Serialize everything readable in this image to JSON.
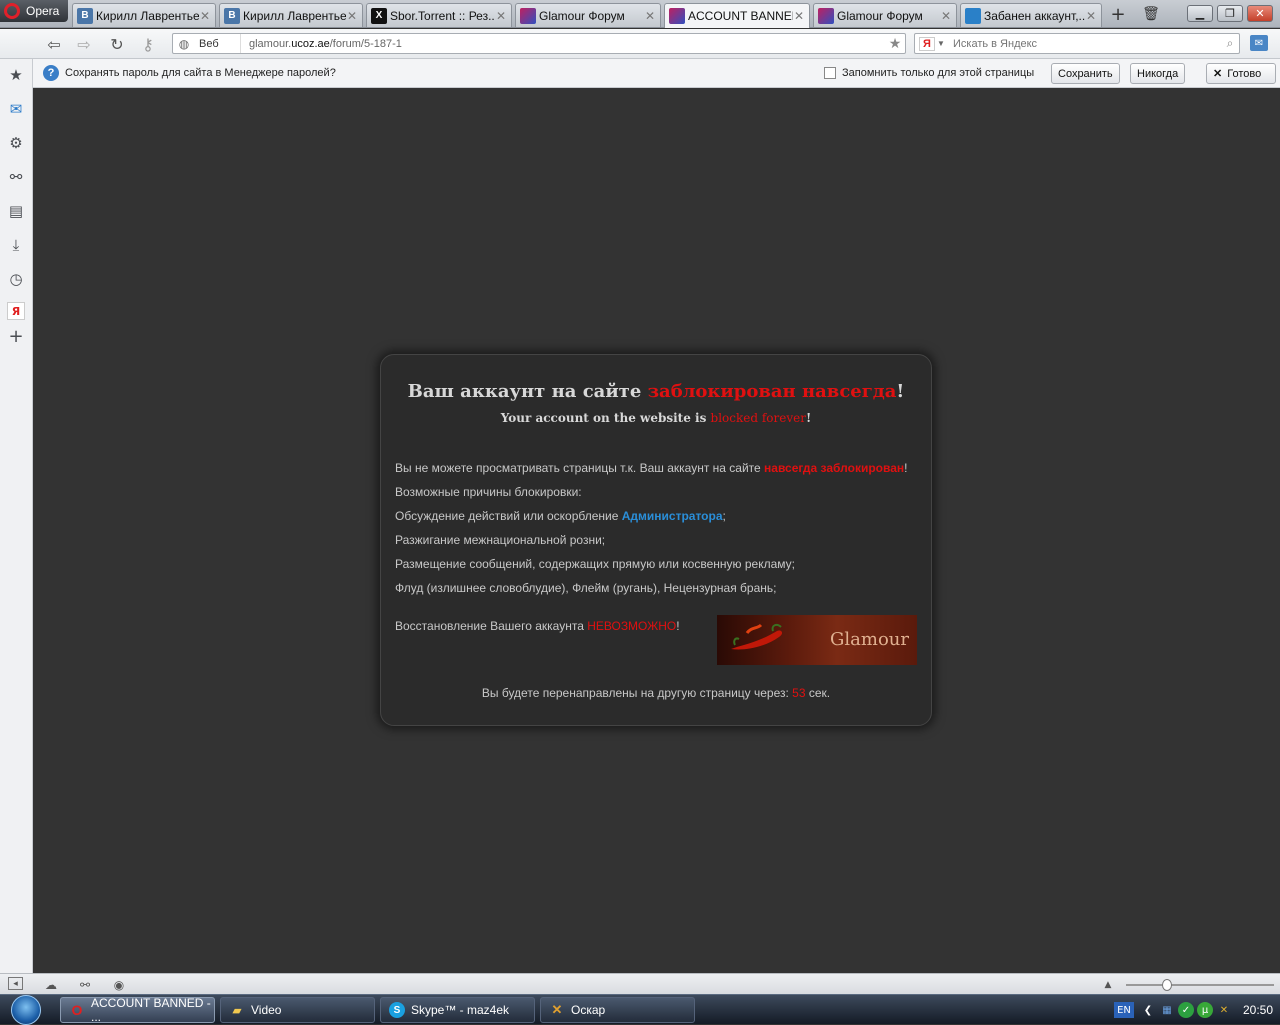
{
  "browser": {
    "menu_label": "Opera",
    "tabs": [
      {
        "label": "Кирилл Лаврентьев",
        "icon": "vk-icon",
        "fav_letter": "B"
      },
      {
        "label": "Кирилл Лаврентьев",
        "icon": "vk-icon",
        "fav_letter": "B"
      },
      {
        "label": "Sbor.Torrent :: Рез...",
        "icon": "torrent-icon",
        "fav_letter": "X"
      },
      {
        "label": "Glamour Форум",
        "icon": "glamour-icon",
        "fav_letter": ""
      },
      {
        "label": "ACCOUNT BANNED",
        "icon": "glamour-icon",
        "fav_letter": "",
        "active": true
      },
      {
        "label": "Glamour Форум",
        "icon": "glamour-icon",
        "fav_letter": ""
      },
      {
        "label": "Забанен аккаунт,...",
        "icon": "ucoz-icon",
        "fav_letter": ""
      }
    ]
  },
  "addressbar": {
    "web_label": "Веб",
    "url_prefix": "glamour.",
    "url_host": "ucoz.ae",
    "url_path": "/forum/5-187-1",
    "search_engine_letter": "Я",
    "search_placeholder": "Искать в Яндекс"
  },
  "password_bar": {
    "info_glyph": "?",
    "message": "Сохранять пароль для сайта в Менеджере паролей?",
    "checkbox_label": "Запомнить только для этой страницы",
    "save_label": "Сохранить",
    "never_label": "Никогда",
    "done_label": "Готово"
  },
  "ban": {
    "title_prefix": "Ваш аккаунт на сайте ",
    "title_red": "заблокирован навсегда",
    "title_suffix": "!",
    "subtitle_prefix": "Your account on the website is ",
    "subtitle_red": "blocked forever",
    "subtitle_suffix": "!",
    "line1_prefix": "Вы не можете просматривать страницы т.к. Ваш аккаунт на сайте ",
    "line1_red": "навсегда заблокирован",
    "line1_suffix": "!",
    "reasons_heading": "Возможные причины блокировки:",
    "reason1_prefix": "Обсуждение действий или оскорбление ",
    "reason1_link": "Администратора",
    "reason1_suffix": ";",
    "reason2": "Разжигание межнациональной розни;",
    "reason3": "Размещение сообщений, содержащих прямую или косвенную рекламу;",
    "reason4": "Флуд (излишнее словоблудие), Флейм (ругань), Нецензурная брань;",
    "restore_prefix": "Восстановление Вашего аккаунта ",
    "restore_red": "НЕВОЗМОЖНО",
    "restore_suffix": "!",
    "banner_brand": "Glamour",
    "redirect_prefix": "Вы будете перенаправлены на другую страницу через: ",
    "redirect_seconds": "53",
    "redirect_suffix": " сек."
  },
  "statusbar": {
    "zoom_fraction": 0.28
  },
  "taskbar": {
    "items": [
      {
        "label": "ACCOUNT BANNED - ...",
        "icon": "opera-icon",
        "active": true
      },
      {
        "label": "Video",
        "icon": "folder-icon"
      },
      {
        "label": "Skype™ - maz4ek",
        "icon": "skype-icon"
      },
      {
        "label": "Оскар",
        "icon": "oscar-icon"
      }
    ],
    "lang": "EN",
    "clock": "20:50"
  },
  "colors": {
    "banned_red": "#e01010",
    "admin_link": "#2a8ed8",
    "page_bg": "#333333",
    "box_bg": "#2b2b2b"
  }
}
